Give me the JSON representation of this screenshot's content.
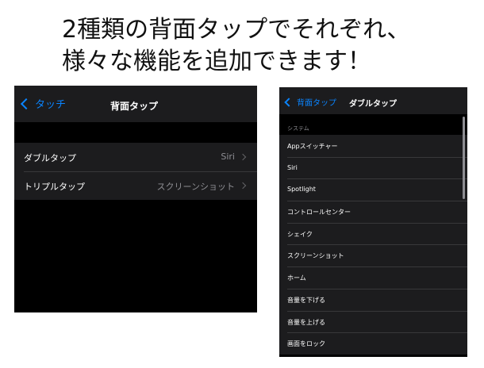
{
  "headline": {
    "line1": "2種類の背面タップでそれぞれ、",
    "line2": "様々な機能を追加できます！"
  },
  "left_screen": {
    "back_label": "タッチ",
    "title": "背面タップ",
    "rows": [
      {
        "label": "ダブルタップ",
        "value": "Siri"
      },
      {
        "label": "トリプルタップ",
        "value": "スクリーンショット"
      }
    ]
  },
  "right_screen": {
    "back_label": "背面タップ",
    "title": "ダブルタップ",
    "section_header": "システム",
    "items": [
      "Appスイッチャー",
      "Siri",
      "Spotlight",
      "コントロールセンター",
      "シェイク",
      "スクリーンショット",
      "ホーム",
      "音量を下げる",
      "音量を上げる",
      "画面をロック"
    ]
  },
  "colors": {
    "accent": "#0a84ff",
    "background_dark": "#000000",
    "cell_dark": "#1c1c1e",
    "secondary_text": "#8e8e93"
  },
  "icons": {
    "back": "chevron-left-icon",
    "disclosure": "chevron-right-icon"
  }
}
